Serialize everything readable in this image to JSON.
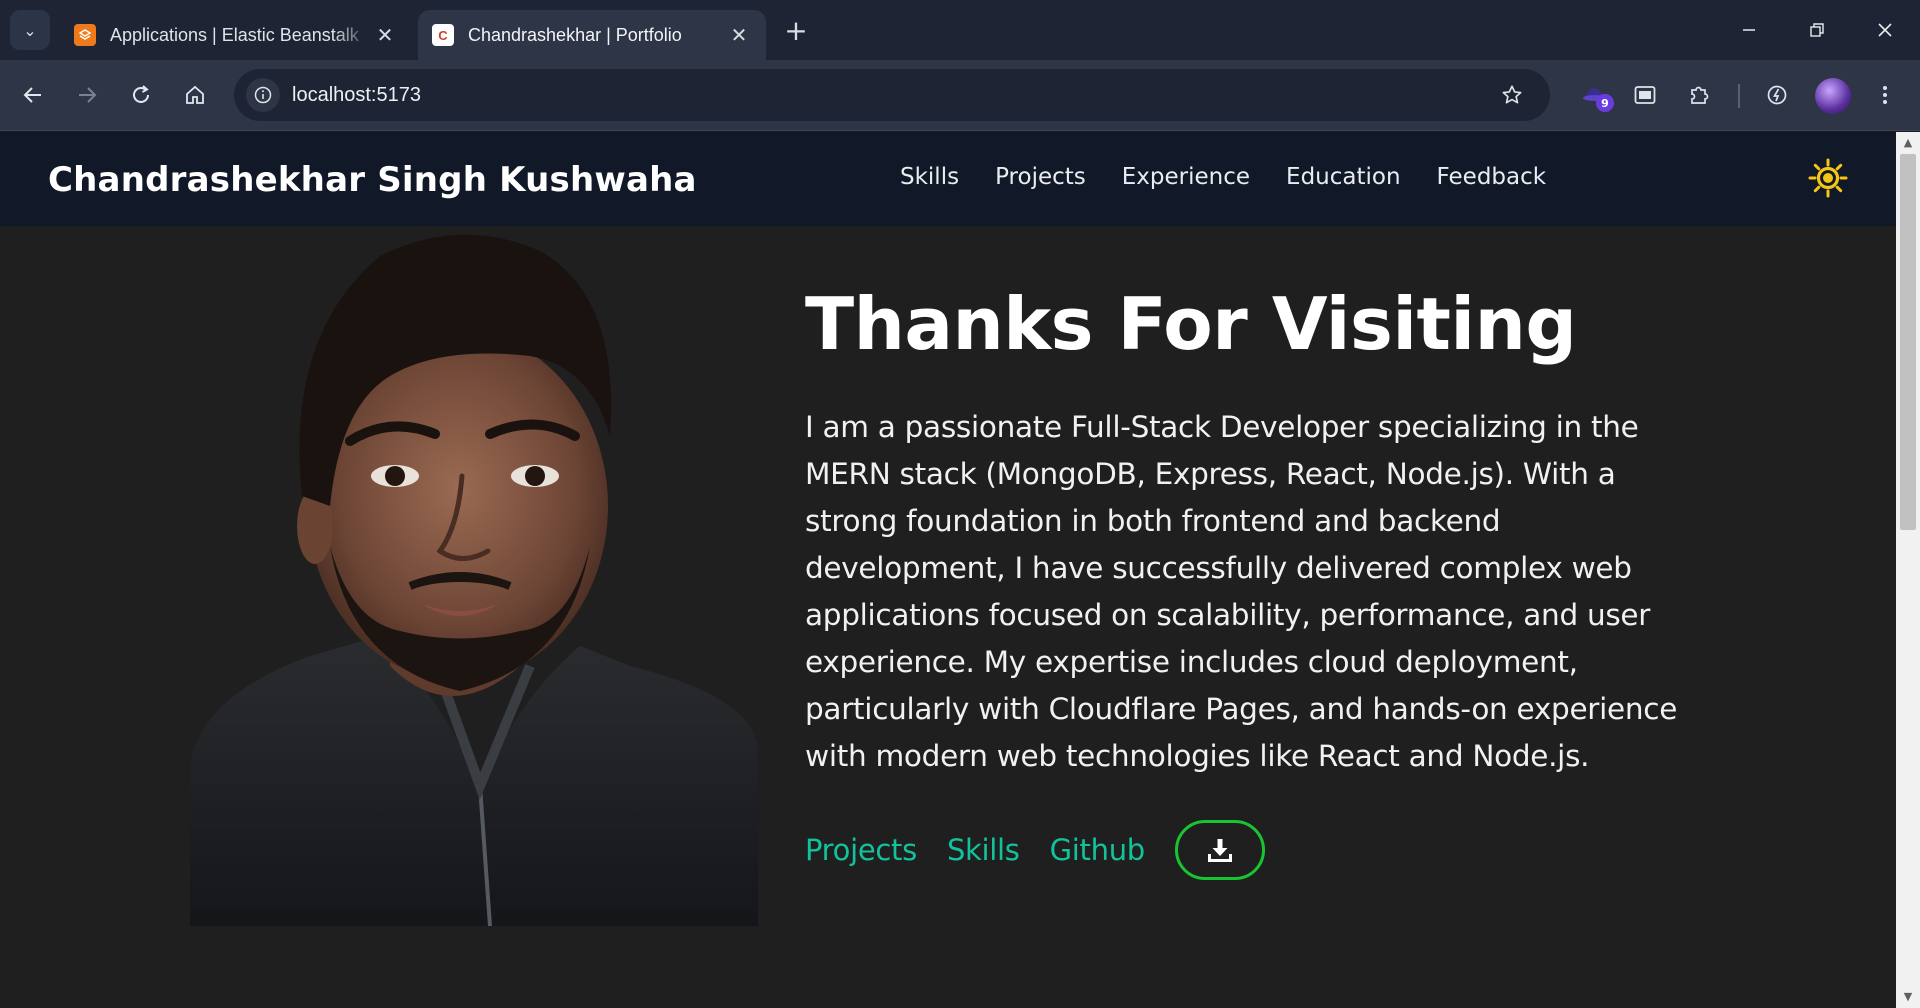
{
  "browser": {
    "tabs": [
      {
        "title": "Applications | Elastic Beanstalk",
        "favicon": "elastic-beanstalk-icon",
        "active": false
      },
      {
        "title": "Chandrashekhar | Portfolio",
        "favicon": "portfolio-c-icon",
        "active": true
      }
    ],
    "tab_close_glyph": "✕",
    "new_tab_glyph": "+",
    "url": "localhost:5173",
    "extension_badge": "9",
    "window_controls": {
      "minimize": "—",
      "restore": "❐",
      "close": "✕"
    },
    "colors": {
      "tabstrip": "#1e2433",
      "toolbar": "#2e3547"
    }
  },
  "site": {
    "brand": "Chandrashekhar Singh Kushwaha",
    "nav": [
      "Skills",
      "Projects",
      "Experience",
      "Education",
      "Feedback"
    ],
    "theme_icon": "sun-icon",
    "hero": {
      "title": "Thanks For Visiting",
      "description": "I am a passionate Full-Stack Developer specializing in the MERN stack (MongoDB, Express, React, Node.js). With a strong foundation in both frontend and backend development, I have successfully delivered complex web applications focused on scalability, performance, and user experience. My expertise includes cloud deployment, particularly with Cloudflare Pages, and hands-on experience with modern web technologies like React and Node.js.",
      "links": [
        "Projects",
        "Skills",
        "Github"
      ],
      "download_icon": "download-icon"
    },
    "colors": {
      "navbar": "#111827",
      "background": "#1f1f1f",
      "link": "#12c29b",
      "button_border": "#19c431",
      "sun": "#f5c518"
    }
  }
}
